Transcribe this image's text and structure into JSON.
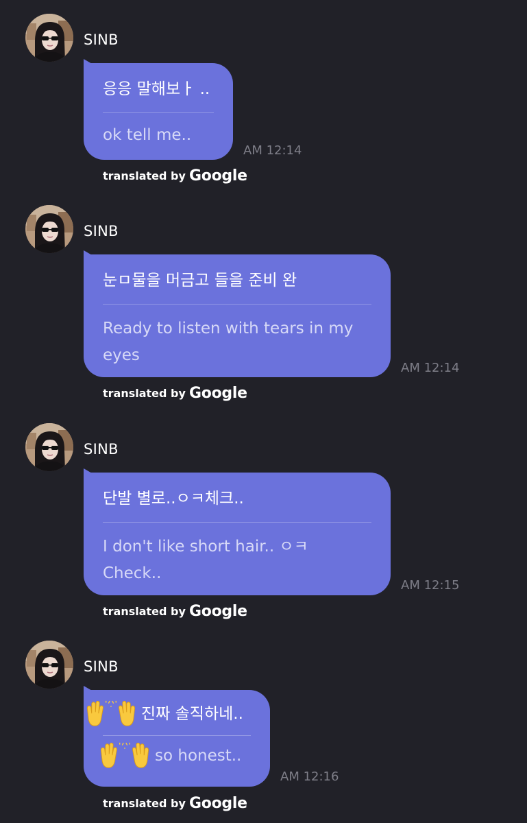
{
  "messages": [
    {
      "sender": "SINB",
      "original": "응응 말해보ㅏ ..",
      "translation": "ok tell me..",
      "time": "AM 12:14",
      "credit_prefix": "translated by",
      "credit_brand": "Google"
    },
    {
      "sender": "SINB",
      "original": "눈ㅁ물을 머금고 들을 준비 완",
      "translation": "Ready to listen with tears in my eyes",
      "time": "AM 12:14",
      "credit_prefix": "translated by",
      "credit_brand": "Google"
    },
    {
      "sender": "SINB",
      "original": "단발 별로..ㅇㅋ체크..",
      "translation": "I don't like short hair.. ㅇㅋ Check..",
      "time": "AM 12:15",
      "credit_prefix": "translated by",
      "credit_brand": "Google"
    },
    {
      "sender": "SINB",
      "original": "진짜 솔직하네..",
      "translation": "so honest..",
      "time": "AM 12:16",
      "credit_prefix": "translated by",
      "credit_brand": "Google",
      "emoji": "raising-hands"
    }
  ],
  "colors": {
    "background": "#212128",
    "bubble": "#6b72dc",
    "translation_text": "#d7d9f7",
    "timestamp": "#7e7e88"
  }
}
